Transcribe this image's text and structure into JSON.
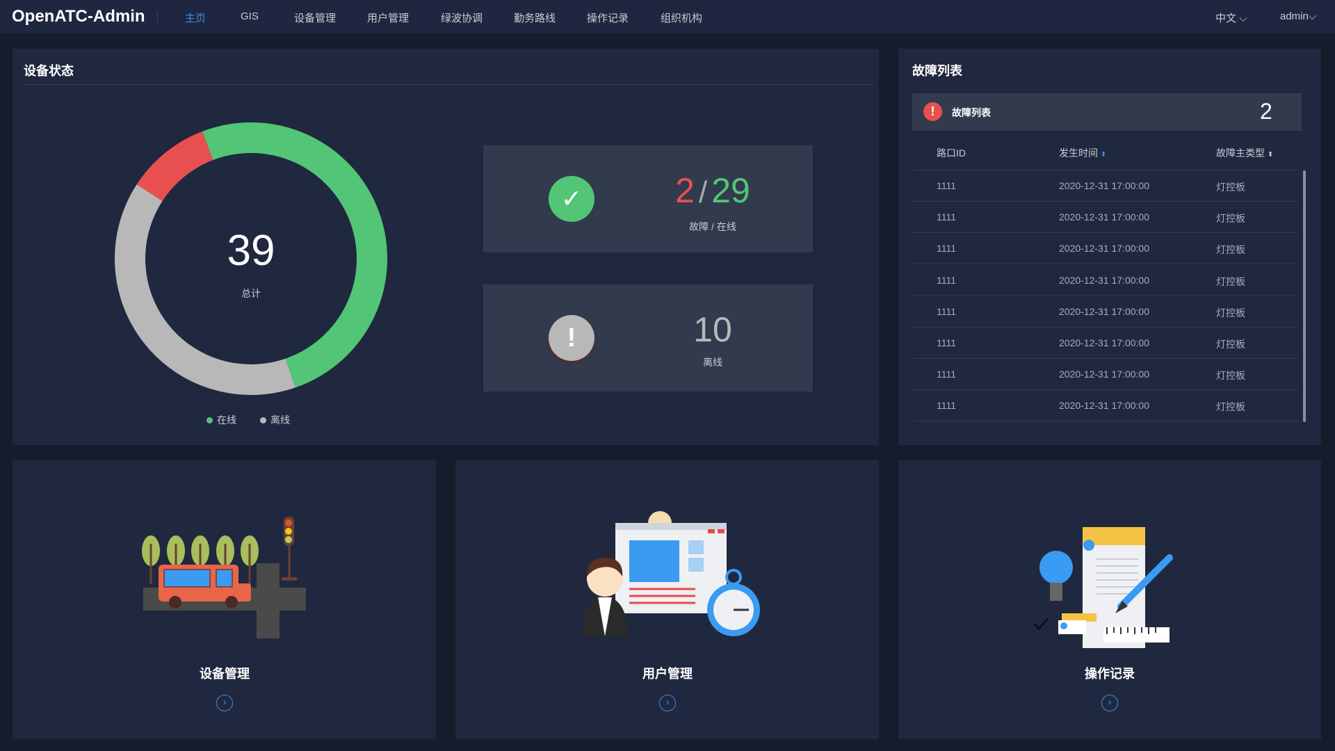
{
  "header": {
    "logo": "OpenATC-Admin",
    "nav": [
      "主页",
      "GIS",
      "设备管理",
      "用户管理",
      "绿波协调",
      "勤务路线",
      "操作记录",
      "组织机构"
    ],
    "language": "中文",
    "user": "admin"
  },
  "device_status": {
    "title": "设备状态",
    "total": "39",
    "total_label": "总计",
    "legend": [
      "在线",
      "离线"
    ],
    "fault": "2",
    "online": "29",
    "separator": "/",
    "fault_online_label": "故障 / 在线",
    "offline": "10",
    "offline_label": "离线",
    "colors": {
      "online": "#52c676",
      "fault": "#e85050",
      "offline": "#b8b8b8"
    }
  },
  "fault_list": {
    "title": "故障列表",
    "banner_label": "故障列表",
    "count": "2",
    "columns": [
      "路口ID",
      "发生时间",
      "故障主类型"
    ],
    "rows": [
      [
        "1111",
        "2020-12-31 17:00:00",
        "灯控板"
      ],
      [
        "1111",
        "2020-12-31 17:00:00",
        "灯控板"
      ],
      [
        "1111",
        "2020-12-31 17:00:00",
        "灯控板"
      ],
      [
        "1111",
        "2020-12-31 17:00:00",
        "灯控板"
      ],
      [
        "1111",
        "2020-12-31 17:00:00",
        "灯控板"
      ],
      [
        "1111",
        "2020-12-31 17:00:00",
        "灯控板"
      ],
      [
        "1111",
        "2020-12-31 17:00:00",
        "灯控板"
      ],
      [
        "1111",
        "2020-12-31 17:00:00",
        "灯控板"
      ]
    ]
  },
  "shortcuts": [
    {
      "label": "设备管理"
    },
    {
      "label": "用户管理"
    },
    {
      "label": "操作记录"
    }
  ]
}
